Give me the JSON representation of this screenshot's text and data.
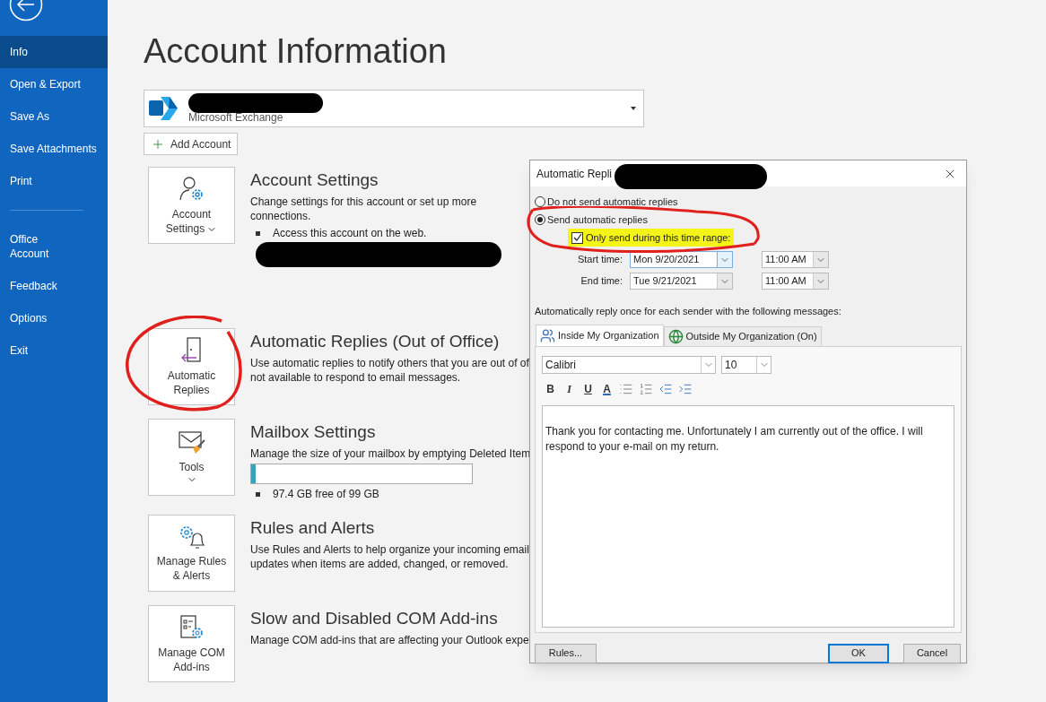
{
  "sidebar": {
    "groups": [
      [
        {
          "label": "Info",
          "selected": true
        },
        {
          "label": "Open & Export",
          "selected": false
        },
        {
          "label": "Save As",
          "selected": false
        },
        {
          "label": "Save Attachments",
          "selected": false
        },
        {
          "label": "Print",
          "selected": false
        }
      ],
      [
        {
          "label": "Office\nAccount",
          "selected": false
        },
        {
          "label": "Feedback",
          "selected": false
        },
        {
          "label": "Options",
          "selected": false
        },
        {
          "label": "Exit",
          "selected": false
        }
      ]
    ]
  },
  "page": {
    "title": "Account Information",
    "account": {
      "type": "Microsoft Exchange"
    },
    "add_account": "Add Account",
    "sections": [
      {
        "kind": "account",
        "tile": "Account Settings",
        "dropdown": true,
        "heading": "Account Settings",
        "description": "Change settings for this account or set up more connections.",
        "bullets": [
          "Access this account on the web."
        ],
        "redacted": true
      },
      {
        "kind": "autoreply",
        "tile": "Automatic Replies",
        "dropdown": false,
        "heading": "Automatic Replies (Out of Office)",
        "description": "Use automatic replies to notify others that you are out of of",
        "extra": "not available to respond to email messages.",
        "circled": true
      },
      {
        "kind": "mailbox",
        "tile": "Tools",
        "dropdown": true,
        "heading": "Mailbox Settings",
        "description": "Manage the size of your mailbox by emptying Deleted Item",
        "level": 0.02,
        "bullets": [
          "97.4 GB free of 99 GB"
        ]
      },
      {
        "kind": "rules",
        "tile": "Manage Rules & Alerts",
        "dropdown": false,
        "heading": "Rules and Alerts",
        "description": "Use Rules and Alerts to help organize your incoming email",
        "extra": "updates when items are added, changed, or removed."
      },
      {
        "kind": "com",
        "tile": "Manage COM Add-ins",
        "dropdown": false,
        "heading": "Slow and Disabled COM Add-ins",
        "description": "Manage COM add-ins that are affecting your Outlook expe"
      }
    ]
  },
  "dialog": {
    "title": "Automatic Repli",
    "options": [
      {
        "label": "Do not send automatic replies",
        "selected": false
      },
      {
        "label": "Send automatic replies",
        "selected": true
      }
    ],
    "time_range": {
      "label": "Only send during this time range:",
      "checked": true
    },
    "times": [
      {
        "label": "Start time:",
        "date": "Mon 9/20/2021",
        "time": "11:00 AM",
        "focused": true
      },
      {
        "label": "End time:",
        "date": "Tue 9/21/2021",
        "time": "11:00 AM",
        "focused": false
      }
    ],
    "instruction": "Automatically reply once for each sender with the following messages:",
    "tabs": [
      {
        "label": "Inside My Organization",
        "selected": true,
        "kind": "inside"
      },
      {
        "label": "Outside My Organization (On)",
        "selected": false,
        "kind": "outside"
      }
    ],
    "font": "Calibri",
    "size": "10",
    "format_buttons": [
      {
        "label": "B",
        "kind": "bold"
      },
      {
        "label": "I",
        "kind": "italic"
      },
      {
        "label": "U",
        "kind": "underline"
      },
      {
        "label": "A",
        "kind": "color"
      }
    ],
    "message": "Thank you for contacting me. Unfortunately I am currently out of the office. I will respond to your e-mail on my return.",
    "buttons": {
      "rules": "Rules...",
      "ok": "OK",
      "cancel": "Cancel"
    }
  }
}
